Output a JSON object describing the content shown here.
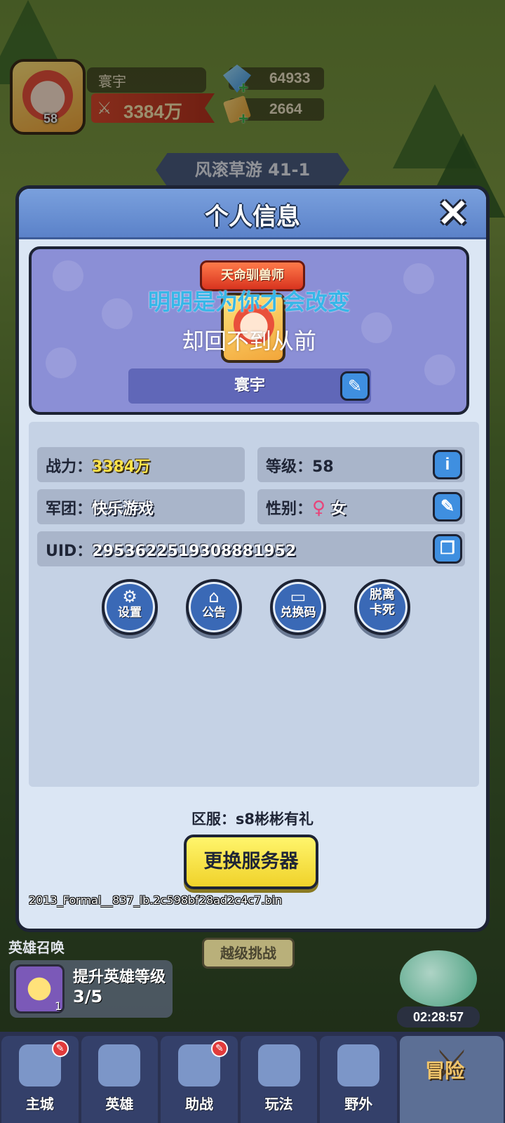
{
  "hud": {
    "player_name": "寰宇",
    "player_level": "58",
    "power": "3384万",
    "gems": "64933",
    "tickets": "2664",
    "stage": "风滚草游 41-1"
  },
  "dialog": {
    "title": "个人信息",
    "close_glyph": "✕",
    "profile": {
      "title_badge": "天命驯兽师",
      "lyric_line1": "明明是为你才会改变",
      "lyric_line2": "却回不到从前",
      "name": "寰宇"
    },
    "info": {
      "power_label": "战力：",
      "power_value": "3384万",
      "level_label": "等级：",
      "level_value": "58",
      "guild_label": "军团：",
      "guild_value": "快乐游戏",
      "gender_label": "性别：",
      "gender_symbol": "♀",
      "gender_value": "女",
      "uid_label": "UID：",
      "uid_value": "2953622519308881952"
    },
    "actions": [
      {
        "label": "设置",
        "icon": "gear-icon"
      },
      {
        "label": "公告",
        "icon": "notice-icon"
      },
      {
        "label": "兑换码",
        "icon": "ticket-icon"
      },
      {
        "label": "脱离\n卡死",
        "icon": "none"
      }
    ],
    "server_label": "区服：s8彬彬有礼",
    "change_server": "更换服务器",
    "debug_text": "2013_Formal__837_lb.2c598bf28ad2c4c7.bin"
  },
  "bottom": {
    "summon_label": "英雄召唤",
    "super_challenge": "越级挑战",
    "quest_title": "提升英雄等级",
    "quest_progress": "3/5",
    "quest_count": "1",
    "timer": "02:28:57"
  },
  "nav": [
    {
      "label": "主城",
      "badge": true
    },
    {
      "label": "英雄",
      "badge": false
    },
    {
      "label": "助战",
      "badge": true
    },
    {
      "label": "玩法",
      "badge": false
    },
    {
      "label": "野外",
      "badge": false
    },
    {
      "label": "冒险",
      "badge": false
    }
  ],
  "colors": {
    "header_blue": "#5b82c9",
    "card_purple": "#8b8fd6",
    "power_gold": "#ffe44a",
    "button_yellow": "#f0d22a",
    "female_pink": "#e8447a"
  }
}
